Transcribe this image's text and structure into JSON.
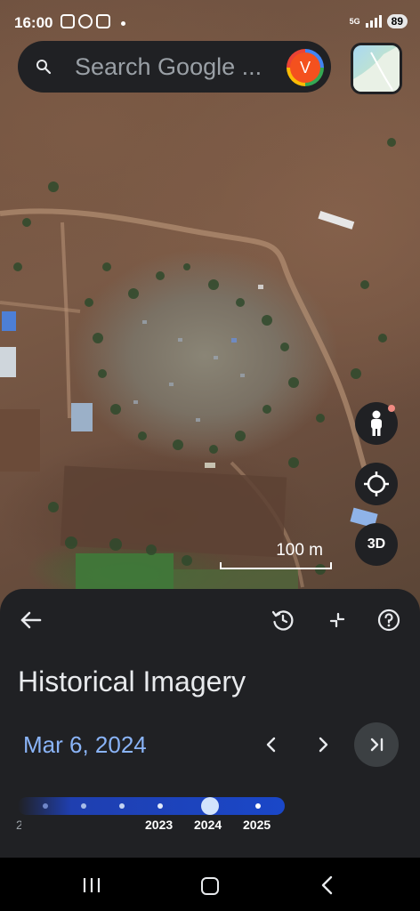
{
  "status_bar": {
    "time": "16:00",
    "network": "5G",
    "battery": "89"
  },
  "search": {
    "placeholder": "Search Google ...",
    "avatar_letter": "V"
  },
  "map": {
    "scale_label": "100 m",
    "three_d_label": "3D",
    "icons": [
      "pegman-icon",
      "my-location-icon",
      "layers-icon"
    ]
  },
  "sheet": {
    "title": "Historical Imagery",
    "date": "Mar 6, 2024",
    "timeline": {
      "years": [
        "2023",
        "2024",
        "2025"
      ],
      "selected_year": "2024",
      "colors": {
        "track": "#1a47c8",
        "knob": "#d2e3fc"
      }
    },
    "icons": [
      "back-arrow-icon",
      "history-icon",
      "collapse-icon",
      "help-icon",
      "chevron-left-icon",
      "chevron-right-icon",
      "skip-to-latest-icon"
    ]
  },
  "nav": {
    "icons": [
      "recents-icon",
      "home-icon",
      "back-icon"
    ]
  },
  "colors": {
    "sheet_bg": "#202124",
    "accent": "#8ab4f8"
  }
}
